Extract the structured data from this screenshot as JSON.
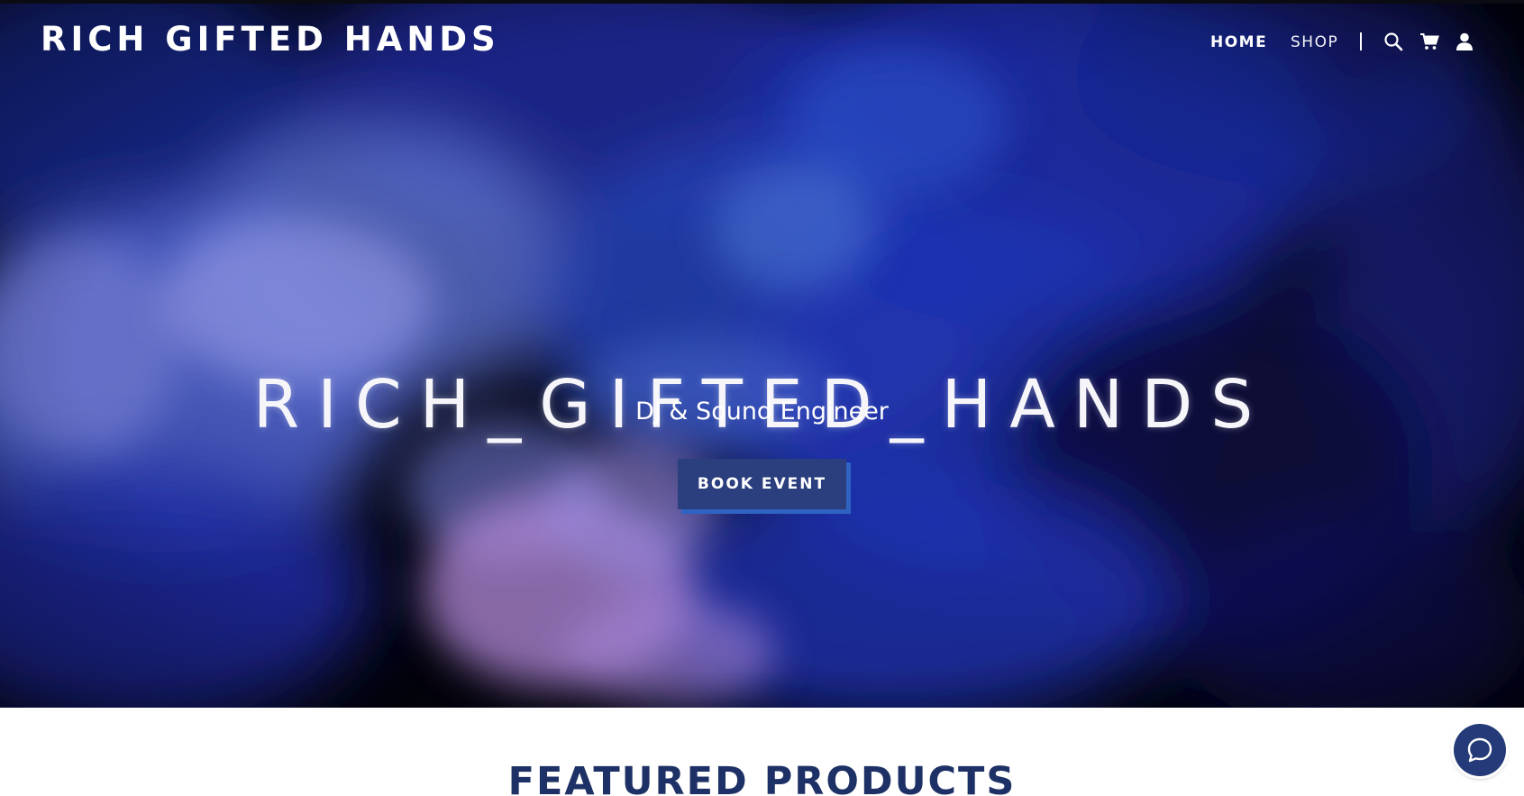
{
  "header": {
    "logo_text": "RICH GIFTED HANDS",
    "nav": {
      "home_label": "HOME",
      "shop_label": "SHOP"
    },
    "icons": [
      "search-icon",
      "cart-icon",
      "account-icon"
    ]
  },
  "hero": {
    "title": "RICH_GIFTED_HANDS",
    "subtitle": "DJ & Sound Engineer",
    "cta_label": "BOOK EVENT"
  },
  "featured": {
    "heading": "FEATURED PRODUCTS"
  },
  "chat": {
    "icon": "chat-bubble-icon"
  },
  "colors": {
    "accent": "#2b3f7e",
    "cta_shadow": "#2e63c2",
    "heading": "#1e3166",
    "hero_dark": "#050510"
  }
}
